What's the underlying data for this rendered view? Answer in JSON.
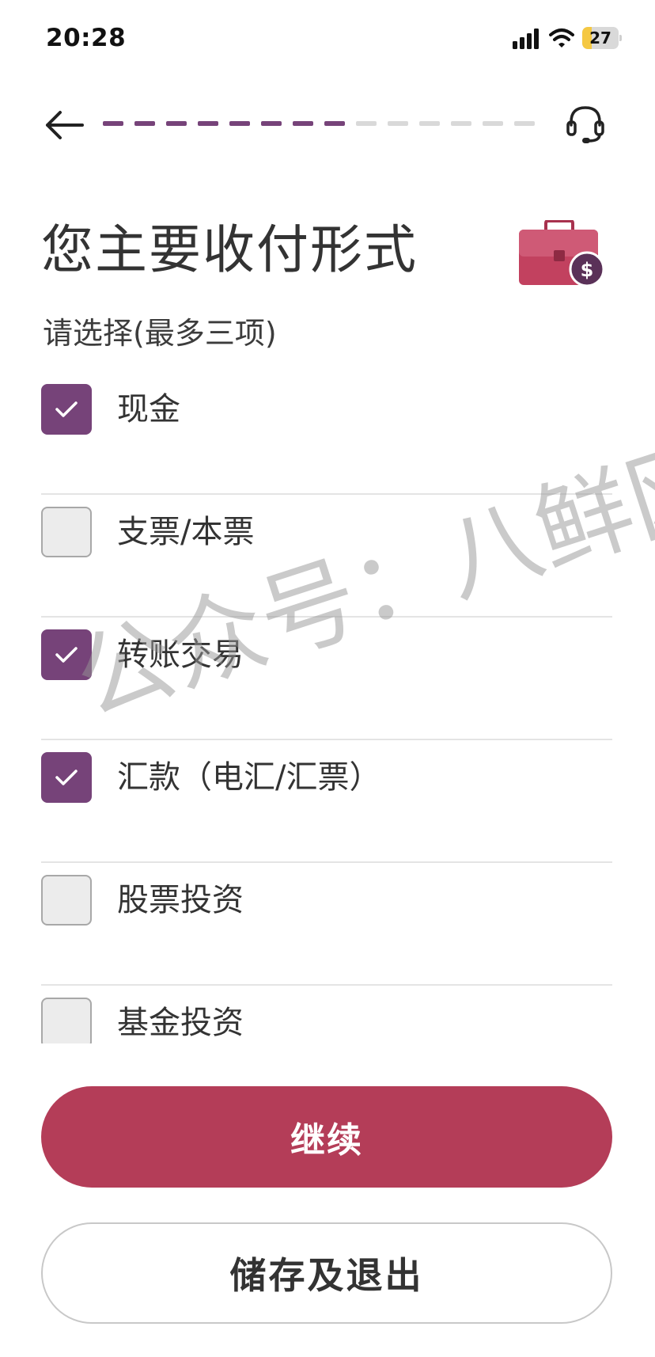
{
  "status_bar": {
    "time": "20:28",
    "battery_level": "27",
    "battery_fraction": 0.27,
    "battery_color": "#f5c842"
  },
  "header": {
    "back_icon": "arrow-left-icon",
    "support_icon": "headset-icon",
    "progress": {
      "completed_steps": 8,
      "total_steps": 14,
      "active_color": "#764379",
      "inactive_color": "#d9d9d9"
    }
  },
  "page": {
    "title": "您主要收付形式",
    "subtitle": "请选择(最多三项)",
    "illustration": "briefcase-dollar-icon"
  },
  "options": [
    {
      "label": "现金",
      "checked": true
    },
    {
      "label": "支票/本票",
      "checked": false
    },
    {
      "label": "转账交易",
      "checked": true
    },
    {
      "label": "汇款（电汇/汇票）",
      "checked": true
    },
    {
      "label": "股票投资",
      "checked": false
    },
    {
      "label": "基金投资",
      "checked": false
    }
  ],
  "buttons": {
    "continue_label": "继续",
    "continue_color": "#b43d58",
    "save_exit_label": "储存及退出"
  },
  "watermark": "公众号：八鲜网",
  "colors": {
    "accent": "#764379",
    "primary_button": "#b43d58"
  }
}
